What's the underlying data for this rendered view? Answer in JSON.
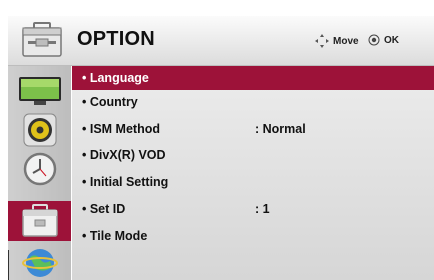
{
  "header": {
    "title": "OPTION",
    "move_label": "Move",
    "ok_label": "OK",
    "icon": "briefcase-icon"
  },
  "sidebar": {
    "items": [
      {
        "name": "picture",
        "icon": "tv-screen-icon",
        "active": false
      },
      {
        "name": "audio",
        "icon": "speaker-icon",
        "active": false
      },
      {
        "name": "time",
        "icon": "clock-icon",
        "active": false
      },
      {
        "name": "option",
        "icon": "briefcase-icon",
        "active": true
      },
      {
        "name": "network",
        "icon": "globe-icon",
        "active": false
      }
    ]
  },
  "menu": {
    "items": [
      {
        "label": "• Language",
        "value": "",
        "selected": true
      },
      {
        "label": "• Country",
        "value": "",
        "selected": false
      },
      {
        "label": "• ISM Method",
        "value": ": Normal",
        "selected": false
      },
      {
        "label": "• DivX(R) VOD",
        "value": "",
        "selected": false
      },
      {
        "label": "• Initial Setting",
        "value": "",
        "selected": false
      },
      {
        "label": "• Set ID",
        "value": ": 1",
        "selected": false
      },
      {
        "label": "• Tile Mode",
        "value": "",
        "selected": false
      }
    ]
  },
  "colors": {
    "accent": "#9d1239",
    "panel": "#e2e2e2",
    "sidebar": "#c7c7c7"
  }
}
